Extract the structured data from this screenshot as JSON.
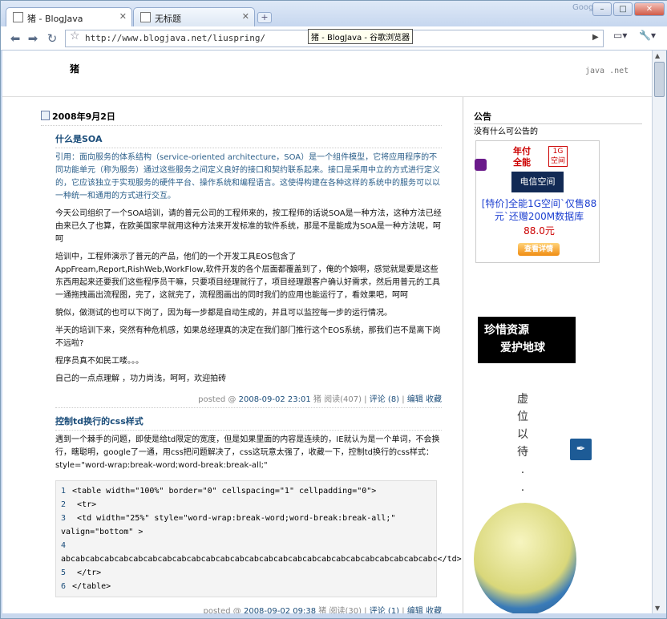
{
  "browser": {
    "tabs": [
      {
        "title": "猪 - BlogJava",
        "active": true
      },
      {
        "title": "无标题",
        "active": false
      }
    ],
    "brand": "Google",
    "url": "http://www.blogjava.net/liuspring/",
    "tooltip": "猪 - BlogJava - 谷歌浏览器"
  },
  "site": {
    "title": "猪",
    "subtitle": "java .net"
  },
  "main": {
    "date": "2008年9月2日",
    "posts": [
      {
        "title": "什么是SOA",
        "quote": "引用：面向服务的体系结构（service-oriented architecture，SOA）是一个组件模型，它将应用程序的不同功能单元（称为服务）通过这些服务之间定义良好的接口和契约联系起来。接口是采用中立的方式进行定义的，它应该独立于实现服务的硬件平台、操作系统和编程语言。这使得构建在各种这样的系统中的服务可以以一种统一和通用的方式进行交互。",
        "paragraphs": [
          "今天公司组织了一个SOA培训，请的普元公司的工程师来的，按工程师的话说SOA是一种方法，这种方法已经由来已久了也算，在欧美国家早就用这种方法来开发标准的软件系统，那是不是能成为SOA是一种方法呢，呵呵",
          "培训中，工程师演示了普元的产品，他们的一个开发工具EOS包含了AppFream,Report,RishWeb,WorkFlow,软件开发的各个层面都覆盖到了，俺的个娘啊，感觉就是要是这些东西用起来还要我们这些程序员干嘛，只要项目经理就行了，项目经理跟客户确认好需求，然后用普元的工具一通拖拽画出流程图，完了，这就完了，流程图画出的同时我们的应用也能运行了，看效果吧，呵呵",
          "貌似，做测试的也可以下岗了，因为每一步都是自动生成的，并且可以监控每一步的运行情况。",
          "半天的培训下来，突然有种危机感，如果总经理真的决定在我们部门推行这个EOS系统，那我们岂不是离下岗不远啦?",
          "程序员真不如民工喽。。。",
          "自己的一点点理解 ，功力尚浅，呵呵，欢迎拍砖"
        ],
        "footer": {
          "prefix": "posted @",
          "time": "2008-09-02 23:01",
          "author": "猪",
          "reads": "阅读(407)",
          "comments": "评论 (8)",
          "edit": "编辑",
          "fav": "收藏"
        }
      },
      {
        "title": "控制td换行的css样式",
        "body": "遇到一个棘手的问题，即使是给td限定的宽度，但是如果里面的内容是连续的，IE就认为是一个单词，不会换行，瞎聪明，google了一通，用css把问题解决了，css这玩意太强了，收藏一下，控制td换行的css样式：style=\"word-wrap:break-word;word-break:break-all;\"",
        "code": [
          {
            "n": "1",
            "text": "<table width=\"100%\" border=\"0\" cellspacing=\"1\" cellpadding=\"0\">"
          },
          {
            "n": "2",
            "text": "  <tr>"
          },
          {
            "n": "3",
            "text": "    <td width=\"25%\" style=\"word-wrap:break-word;word-break:break-all;\"  valign=\"bottom\" >"
          },
          {
            "n": "4",
            "text": "    abcabcabcabcabcabcabcabcabcabcabcabcabcabcabcabcabcabcabcabcabcabcabcabcabcabc</td>"
          },
          {
            "n": "5",
            "text": "  </tr>"
          },
          {
            "n": "6",
            "text": "</table>"
          }
        ],
        "footer": {
          "prefix": "posted @",
          "time": "2008-09-02 09:38",
          "author": "猪",
          "reads": "阅读(30)",
          "comments": "评论 (1)",
          "edit": "编辑",
          "fav": "收藏"
        }
      }
    ]
  },
  "sidebar": {
    "heading": "公告",
    "text": "没有什么可公告的",
    "ad": {
      "tag_line1": "年付",
      "tag_line2": "全能",
      "badge": "1G 空间",
      "box": "电信空间",
      "link": "[特价]全能1G空间`仅售88元`还赠200M数据库",
      "price": "88.0元",
      "button": "查看详情"
    },
    "banner": {
      "line1": "珍惜资源",
      "line2": "爱护地球"
    },
    "vertical": [
      "虚",
      "位",
      "以",
      "待",
      ".",
      ".",
      "."
    ]
  }
}
